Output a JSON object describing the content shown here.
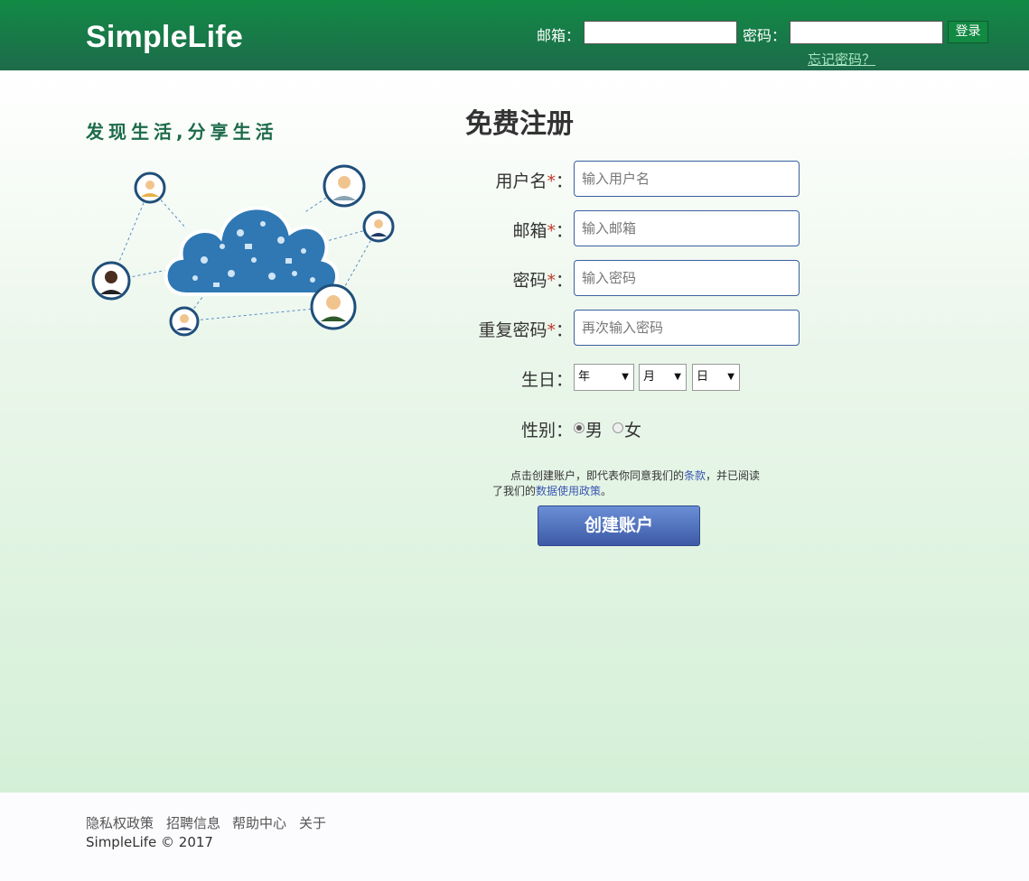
{
  "header": {
    "brand": "SimpleLife",
    "email_label": "邮箱：",
    "password_label": "密码：",
    "login_button": "登录",
    "forgot_link": "忘记密码？"
  },
  "left": {
    "slogan": "发现生活,分享生活"
  },
  "register": {
    "title": "免费注册",
    "fields": [
      {
        "label": "用户名",
        "required": "*",
        "placeholder": "输入用户名"
      },
      {
        "label": "邮箱",
        "required": "*",
        "placeholder": "输入邮箱"
      },
      {
        "label": "密码",
        "required": "*",
        "placeholder": "输入密码"
      },
      {
        "label": "重复密码",
        "required": "*",
        "placeholder": "再次输入密码"
      }
    ],
    "colon": "：",
    "birthday": {
      "label": "生日：",
      "year": "年",
      "month": "月",
      "day": "日"
    },
    "gender": {
      "label": "性别：",
      "male": "男",
      "female": "女",
      "selected": "男"
    },
    "terms": {
      "part1": "点击创建账户，即代表你同意我们的",
      "terms_link": "条款",
      "part2": "，并已阅读了我们的",
      "policy_link": "数据使用政策",
      "part3": "。"
    },
    "create_button": "创建账户"
  },
  "footer": {
    "links": [
      "隐私权政策",
      "招聘信息",
      "帮助中心",
      "关于"
    ],
    "copyright": "SimpleLife © 2017"
  },
  "colors": {
    "header_top": "#128a45",
    "header_bottom": "#1d6b4a",
    "button_blue": "#3d5aa6",
    "link_blue": "#3a56b0",
    "required_red": "#c0392b"
  }
}
